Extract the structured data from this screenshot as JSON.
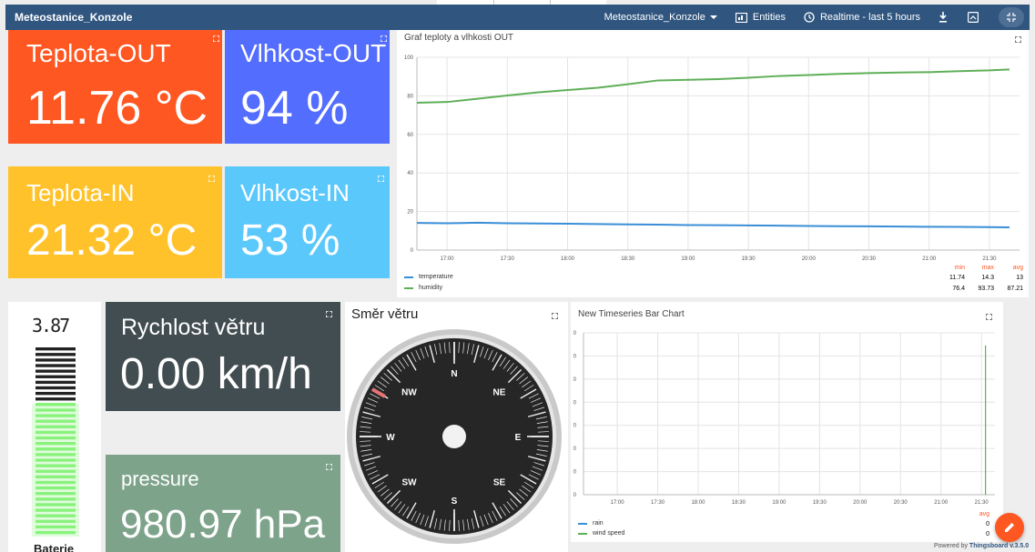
{
  "app": {
    "title": "Meteostanice_Konzole",
    "dashboard_selector": "Meteostanice_Konzole",
    "entities_label": "Entities",
    "timewindow_label": "Realtime - last 5 hours",
    "powered_prefix": "Powered by",
    "powered_brand": "Thingsboard v.3.5.0"
  },
  "colors": {
    "topbar": "#305680",
    "teplota_out": "#ff5722",
    "vlhkost_out": "#536dfe",
    "teplota_in": "#ffc22b",
    "vlhkost_in": "#5bc8fc",
    "rychlost": "#424d51",
    "pressure": "#7da38a",
    "temperature_series": "#3a8ed8",
    "humidity_series": "#5faf58",
    "fab": "#ff5722"
  },
  "tiles": {
    "teplota_out": {
      "label": "Teplota-OUT",
      "value": "11.76 °C"
    },
    "vlhkost_out": {
      "label": "Vlhkost-OUT",
      "value": "94 %"
    },
    "teplota_in": {
      "label": "Teplota-IN",
      "value": "21.32 °C"
    },
    "vlhkost_in": {
      "label": "Vlhkost-IN",
      "value": "53 %"
    },
    "rychlost": {
      "label": "Rychlost větru",
      "value": "0.00 km/h"
    },
    "pressure": {
      "label": "pressure",
      "value": "980.97 hPa"
    }
  },
  "battery": {
    "value": "3.87",
    "label": "Baterie",
    "level": 0.7
  },
  "compass": {
    "title": "Směr větru",
    "labels": [
      "N",
      "NE",
      "E",
      "SE",
      "S",
      "SW",
      "W",
      "NW"
    ],
    "direction_deg": 300
  },
  "chart_data": [
    {
      "type": "line",
      "title": "Graf teploty a vlhkosti OUT",
      "ylim": [
        0,
        100
      ],
      "y_ticks": [
        "0",
        "20",
        "40",
        "60",
        "80",
        "100"
      ],
      "x_ticks": [
        "17:00",
        "17:30",
        "18:00",
        "18:30",
        "19:00",
        "19:30",
        "20:00",
        "20:30",
        "21:00",
        "21:30"
      ],
      "x": [
        "16:45",
        "17:00",
        "17:15",
        "17:30",
        "17:45",
        "18:00",
        "18:15",
        "18:30",
        "18:45",
        "19:00",
        "19:15",
        "19:30",
        "19:45",
        "20:00",
        "20:15",
        "20:30",
        "20:45",
        "21:00",
        "21:15",
        "21:30",
        "21:40"
      ],
      "series": [
        {
          "name": "temperature",
          "color": "#3a8ed8",
          "values": [
            14.1,
            13.9,
            14.2,
            13.9,
            13.8,
            13.7,
            13.5,
            13.3,
            13.2,
            13.0,
            12.9,
            12.8,
            12.7,
            12.5,
            12.4,
            12.3,
            12.2,
            12.1,
            12.0,
            11.9,
            11.8
          ]
        },
        {
          "name": "humidity",
          "color": "#5faf58",
          "values": [
            76.4,
            76.8,
            78.5,
            80.2,
            81.8,
            83.0,
            84.2,
            86.0,
            88.0,
            88.3,
            88.7,
            89.4,
            90.3,
            90.8,
            91.4,
            91.8,
            92.1,
            92.3,
            92.8,
            93.2,
            93.7
          ]
        }
      ],
      "stats_headers": [
        "min",
        "max",
        "avg"
      ],
      "stats": [
        {
          "name": "temperature",
          "min": "11.74",
          "max": "14.3",
          "avg": "13"
        },
        {
          "name": "humidity",
          "min": "76.4",
          "max": "93.73",
          "avg": "87.21"
        }
      ]
    },
    {
      "type": "bar",
      "title": "New Timeseries Bar Chart",
      "y_ticks": [
        "0",
        "0",
        "0",
        "0",
        "0",
        "0",
        "0",
        "0"
      ],
      "x_ticks": [
        "17:00",
        "17:30",
        "18:00",
        "18:30",
        "19:00",
        "19:30",
        "20:00",
        "20:30",
        "21:00",
        "21:30"
      ],
      "series": [
        {
          "name": "rain",
          "color": "#3a8ed8",
          "avg": "0"
        },
        {
          "name": "wind speed",
          "color": "#5faf58",
          "avg": "0"
        }
      ],
      "stats_header": "avg"
    }
  ]
}
